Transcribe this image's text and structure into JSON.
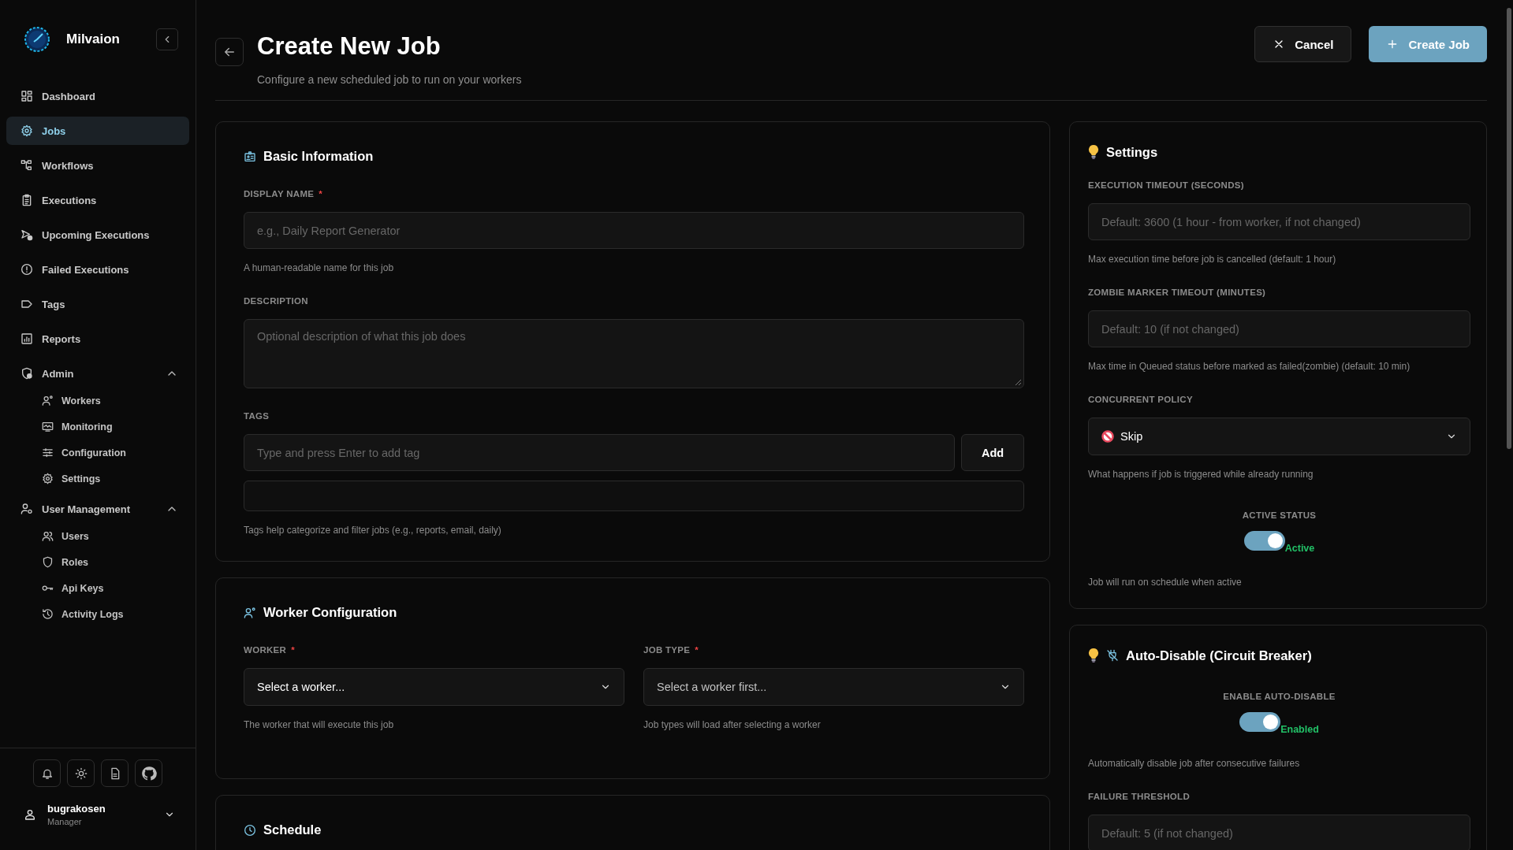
{
  "sidebar": {
    "brand": "Milvaion",
    "nav": [
      {
        "label": "Dashboard",
        "selected": false
      },
      {
        "label": "Jobs",
        "selected": true
      },
      {
        "label": "Workflows",
        "selected": false
      },
      {
        "label": "Executions",
        "selected": false
      },
      {
        "label": "Upcoming Executions",
        "selected": false
      },
      {
        "label": "Failed Executions",
        "selected": false
      },
      {
        "label": "Tags",
        "selected": false
      },
      {
        "label": "Reports",
        "selected": false
      },
      {
        "label": "Admin",
        "selected": false,
        "expanded": true,
        "children": [
          {
            "label": "Workers",
            "selected": false
          },
          {
            "label": "Monitoring",
            "selected": false
          },
          {
            "label": "Configuration",
            "selected": false
          },
          {
            "label": "Settings",
            "selected": false
          }
        ]
      },
      {
        "label": "User Management",
        "selected": false,
        "expanded": true,
        "children": [
          {
            "label": "Users",
            "selected": false
          },
          {
            "label": "Roles",
            "selected": false
          },
          {
            "label": "Api Keys",
            "selected": false
          },
          {
            "label": "Activity Logs",
            "selected": false
          }
        ]
      }
    ],
    "user": {
      "name": "bugrakosen",
      "role": "Manager"
    }
  },
  "header": {
    "title": "Create New Job",
    "subtitle": "Configure a new scheduled job to run on your workers",
    "buttons": [
      {
        "label": "Cancel",
        "kind": "secondary"
      },
      {
        "label": "Create Job",
        "kind": "primary"
      }
    ]
  },
  "sections": [
    {
      "title": "Basic Information",
      "fields": [
        {
          "kind": "text",
          "label": "DISPLAY NAME",
          "required_mark": "*",
          "placeholder": "e.g., Daily Report Generator",
          "hint": "A human-readable name for this job"
        },
        {
          "kind": "textarea",
          "label": "DESCRIPTION",
          "placeholder": "Optional description of what this job does"
        },
        {
          "kind": "tags",
          "label": "TAGS",
          "placeholder": "Type and press Enter to add tag",
          "button": "Add",
          "hint": "Tags help categorize and filter jobs (e.g., reports, email, daily)"
        }
      ]
    },
    {
      "title": "Worker Configuration",
      "kind": "columns",
      "fields": [
        {
          "kind": "select",
          "label": "WORKER",
          "required_mark": "*",
          "value": "Select a worker...",
          "disabled": false,
          "hint": "The worker that will execute this job"
        },
        {
          "kind": "select",
          "label": "JOB TYPE",
          "required_mark": "*",
          "value": "Select a worker first...",
          "disabled": true,
          "hint": "Job types will load after selecting a worker"
        }
      ]
    },
    {
      "title": "Schedule"
    }
  ],
  "side_sections": [
    {
      "title": "Settings",
      "fields": [
        {
          "kind": "text",
          "label": "EXECUTION TIMEOUT (SECONDS)",
          "placeholder": "Default: 3600 (1 hour - from worker, if not changed)",
          "hint": "Max execution time before job is cancelled (default: 1 hour)"
        },
        {
          "kind": "text",
          "label": "ZOMBIE MARKER TIMEOUT (MINUTES)",
          "placeholder": "Default: 10 (if not changed)",
          "hint": "Max time in Queued status before marked as failed(zombie) (default: 10 min)"
        },
        {
          "kind": "select",
          "label": "CONCURRENT POLICY",
          "value": "Skip",
          "disabled": false,
          "hint": "What happens if job is triggered while already running"
        },
        {
          "kind": "toggle",
          "label": "ACTIVE STATUS",
          "on": true,
          "state_label": "Active",
          "hint": "Job will run on schedule when active"
        }
      ]
    },
    {
      "title": "Auto-Disable (Circuit Breaker)",
      "fields": [
        {
          "kind": "toggle",
          "label": "ENABLE AUTO-DISABLE",
          "on": true,
          "state_label": "Enabled",
          "hint": "Automatically disable job after consecutive failures"
        },
        {
          "kind": "text",
          "label": "FAILURE THRESHOLD",
          "placeholder": "Default: 5 (if not changed)"
        }
      ]
    }
  ]
}
